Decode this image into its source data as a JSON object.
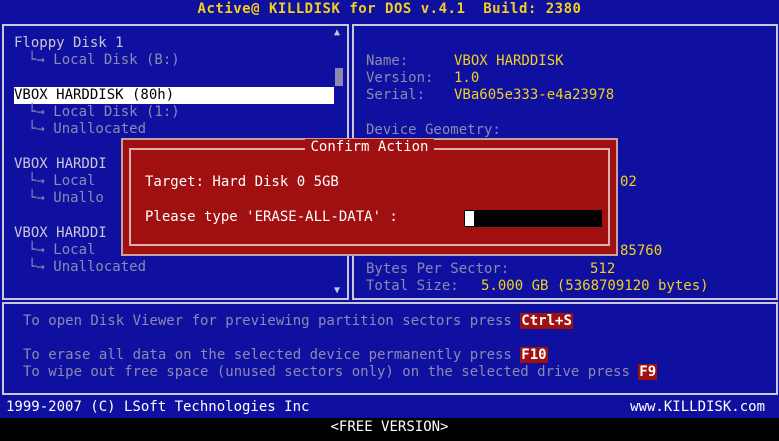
{
  "title": "Active@ KILLDISK for DOS v.4.1  Build: 2380",
  "devices": {
    "floppy": {
      "label": "Floppy Disk 1",
      "children": [
        "└→ Local Disk (B:)"
      ]
    },
    "vbox1": {
      "label": "VBOX HARDDISK (80h)",
      "children": [
        "└→ Local Disk (1:)",
        "└→ Unallocated"
      ]
    },
    "vbox2": {
      "label": "VBOX HARDDI",
      "children": [
        "└→ Local",
        "└→ Unallo"
      ]
    },
    "vbox3": {
      "label": "VBOX HARDDI",
      "children": [
        "└→ Local",
        "└→ Unallocated"
      ]
    }
  },
  "info": {
    "name_label": "Name:",
    "name_value": "VBOX HARDDISK",
    "version_label": "Version:",
    "version_value": "1.0",
    "serial_label": "Serial:",
    "serial_value": "VBa605e333-e4a23978",
    "geometry_label": "Device Geometry:",
    "partial_value_1": "02",
    "partial_value_2": "85760",
    "bps_label": "Bytes Per Sector:",
    "bps_value": "512",
    "total_label": "Total Size:",
    "total_value": "5.000 GB (5368709120 bytes)"
  },
  "dialog": {
    "title": "Confirm Action",
    "target": "Target: Hard Disk 0 5GB",
    "prompt": "Please type 'ERASE-ALL-DATA' :",
    "input_value": ""
  },
  "help": {
    "line1_text": "To open Disk Viewer for previewing partition sectors press ",
    "line1_key": "Ctrl+S",
    "line2_text": "To erase all data on the selected device permanently press ",
    "line2_key": "F10",
    "line3_text": "To wipe out free space (unused sectors only) on the selected drive press ",
    "line3_key": "F9"
  },
  "footer": {
    "copyright": "1999-2007 (C) LSoft Technologies Inc",
    "website": "www.KILLDISK.com",
    "version": "<FREE VERSION>"
  },
  "colors": {
    "background": "#1010a0",
    "title_yellow": "#f0d020",
    "dialog_red": "#a01010",
    "selected_bg": "#ffffff"
  }
}
